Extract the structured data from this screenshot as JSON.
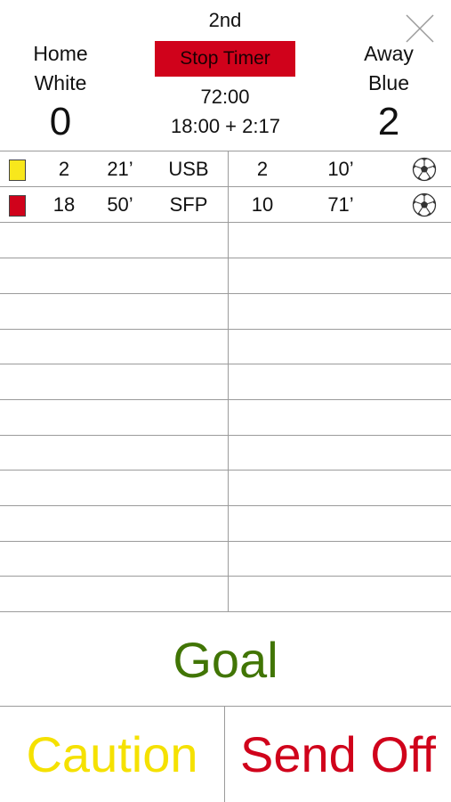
{
  "header": {
    "period": "2nd",
    "stop_timer_label": "Stop Timer",
    "game_clock": "72:00",
    "half_clock": "18:00 + 2:17",
    "home": {
      "label": "Home",
      "color_name": "White",
      "score": "0"
    },
    "away": {
      "label": "Away",
      "color_name": "Blue",
      "score": "2"
    }
  },
  "events": {
    "home": [
      {
        "card": "yellow",
        "player": "2",
        "minute": "21’",
        "code": "USB"
      },
      {
        "card": "red",
        "player": "18",
        "minute": "50’",
        "code": "SFP"
      }
    ],
    "away": [
      {
        "player": "2",
        "minute": "10’",
        "icon": "soccer-ball-icon"
      },
      {
        "player": "10",
        "minute": "71’",
        "icon": "soccer-ball-icon"
      }
    ]
  },
  "actions": {
    "goal_label": "Goal",
    "caution_label": "Caution",
    "send_off_label": "Send Off"
  },
  "colors": {
    "stop_timer_bg": "#d0021b",
    "goal": "#417505",
    "caution": "#f5e100",
    "send_off": "#d0021b",
    "yellow_card": "#f8e71c",
    "red_card": "#d0021b"
  }
}
